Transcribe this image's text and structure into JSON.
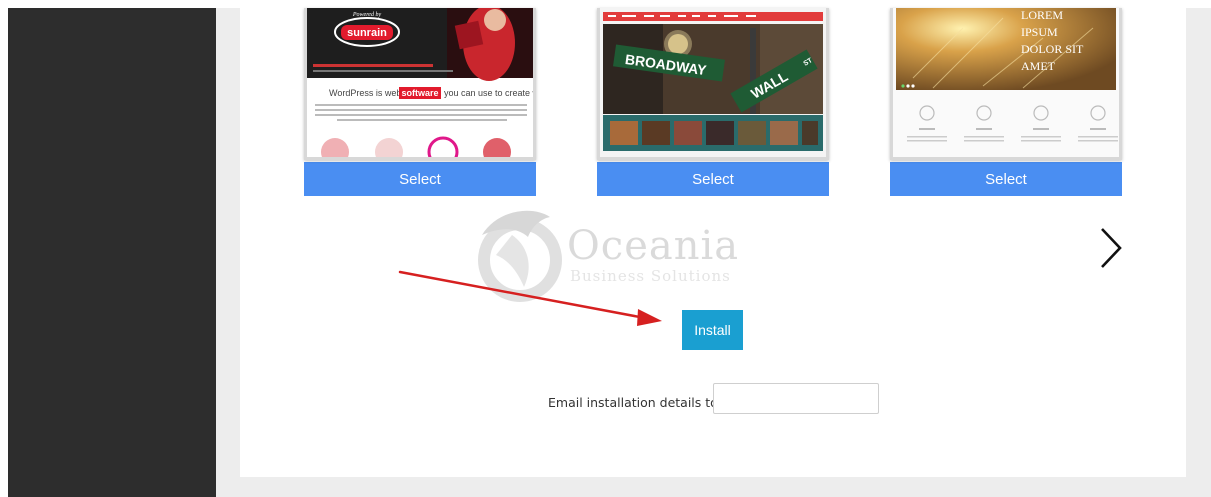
{
  "themes": [
    {
      "select_label": "Select",
      "logo_text": "sunrain",
      "powered_by": "Powered by",
      "tagline_pre": "WordPress is web",
      "tagline_highlight": "software",
      "tagline_post": "you can use to create w",
      "accent": "#e21b2d"
    },
    {
      "select_label": "Select",
      "sign1": "BROADWAY",
      "sign2": "WALL",
      "sign2_suffix": "ST",
      "accent": "#e23c3c"
    },
    {
      "select_label": "Select",
      "hero_text": [
        "LOREM",
        "IPSUM",
        "DOLOR SIT",
        "AMET"
      ],
      "accent": "#c4913b"
    }
  ],
  "watermark": {
    "title": "Oceania",
    "subtitle": "Business Solutions"
  },
  "carousel": {
    "next_icon": "chevron-right-icon"
  },
  "install": {
    "label": "Install",
    "color": "#1a9fd1"
  },
  "email": {
    "label": "Email installation details to :",
    "value": "",
    "placeholder": ""
  },
  "annotation": {
    "arrow_color": "#d62020"
  },
  "colors": {
    "sidebar": "#2d2d2d",
    "background": "#ededed",
    "select_button": "#4a8ef2"
  }
}
